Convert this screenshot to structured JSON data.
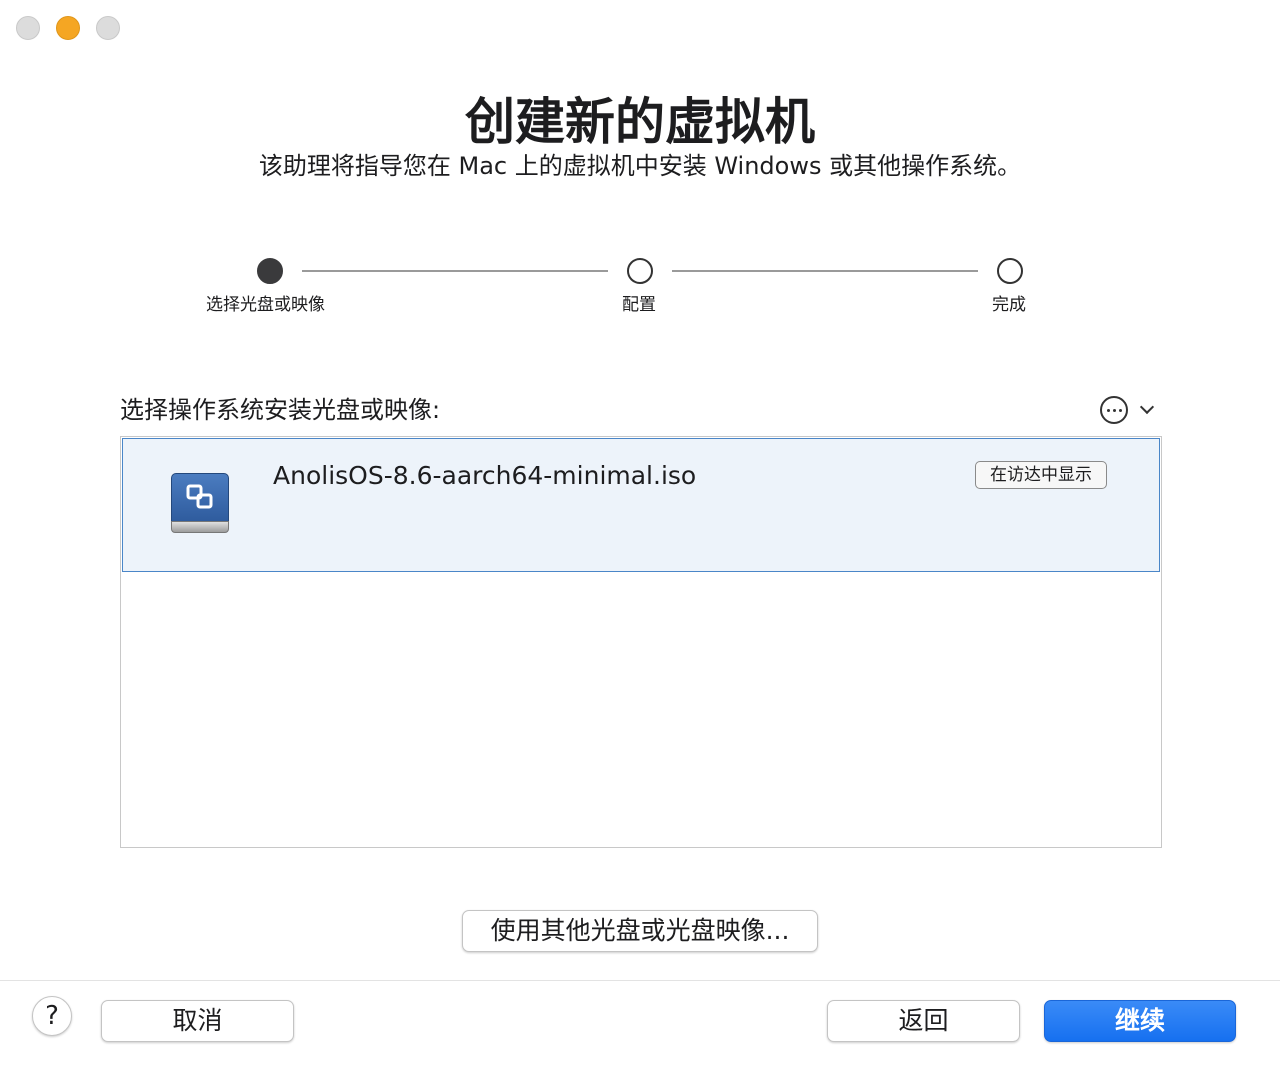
{
  "window": {
    "controls": [
      "close",
      "minimize",
      "zoom"
    ]
  },
  "header": {
    "title": "创建新的虚拟机",
    "subtitle": "该助理将指导您在 Mac 上的虚拟机中安装 Windows 或其他操作系统。"
  },
  "steps": [
    {
      "label": "选择光盘或映像",
      "state": "active"
    },
    {
      "label": "配置",
      "state": "pending"
    },
    {
      "label": "完成",
      "state": "pending"
    }
  ],
  "source": {
    "label": "选择操作系统安装光盘或映像:",
    "more_icon": "ellipsis-circle-icon",
    "dropdown_icon": "chevron-down-icon",
    "items": [
      {
        "name": "AnolisOS-8.6-aarch64-minimal.iso",
        "icon": "disk-image-icon",
        "action": "在访达中显示",
        "selected": true
      }
    ]
  },
  "other_disc_button": "使用其他光盘或光盘映像...",
  "footer": {
    "help": "?",
    "cancel": "取消",
    "back": "返回",
    "continue": "继续"
  },
  "colors": {
    "accent": "#1670f0",
    "selection_bg": "#edf3fa",
    "selection_border": "#4a86c8",
    "minimize": "#f5a623"
  }
}
